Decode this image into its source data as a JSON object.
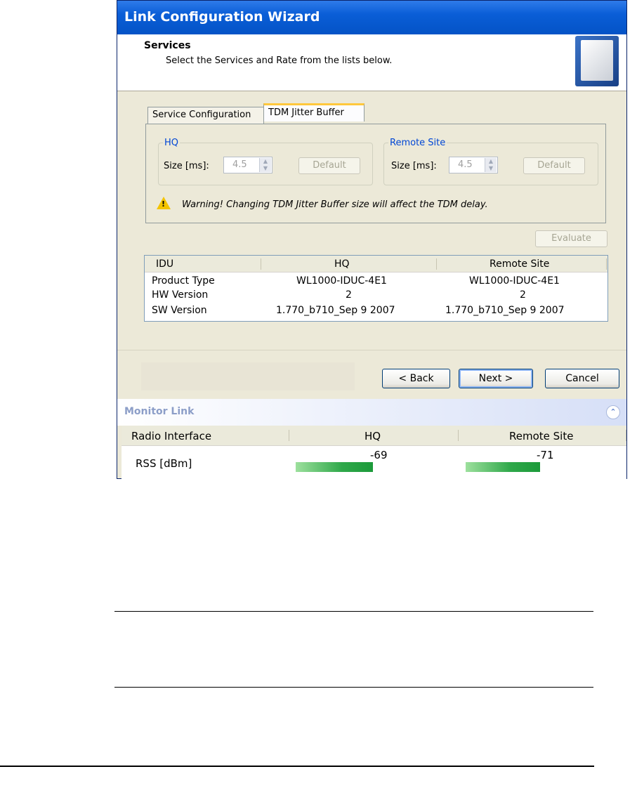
{
  "window": {
    "title": "Link Configuration Wizard",
    "header_title": "Services",
    "header_subtitle": "Select the Services and Rate from the lists below.",
    "logo_icon": "antenna-panel-icon"
  },
  "tabs": [
    {
      "label": "Service Configuration",
      "active": false
    },
    {
      "label": "TDM Jitter Buffer",
      "active": true
    }
  ],
  "jitter": {
    "hq": {
      "legend": "HQ",
      "size_label": "Size [ms]:",
      "value": "4.5",
      "default_label": "Default"
    },
    "remote": {
      "legend": "Remote Site",
      "size_label": "Size [ms]:",
      "value": "4.5",
      "default_label": "Default"
    },
    "warning": "Warning! Changing TDM Jitter Buffer size will affect the TDM delay.",
    "warning_icon": "warning-triangle-icon"
  },
  "evaluate_label": "Evaluate",
  "idu_table": {
    "columns": [
      "IDU",
      "HQ",
      "Remote Site"
    ],
    "rows": [
      [
        "Product Type",
        "WL1000-IDUC-4E1",
        "WL1000-IDUC-4E1"
      ],
      [
        "HW Version",
        "2",
        "2"
      ],
      [
        "SW Version",
        "1.770_b710_Sep  9 2007",
        "1.770_b710_Sep  9 2007"
      ]
    ]
  },
  "buttons": {
    "back": "< Back",
    "next": "Next >",
    "cancel": "Cancel"
  },
  "monitor": {
    "title": "Monitor Link",
    "collapse_icon": "double-chevron-up-icon",
    "columns": [
      "Radio Interface",
      "HQ",
      "Remote Site"
    ],
    "row_label": "RSS [dBm]",
    "hq_value": "-69",
    "remote_value": "-71",
    "hq_level": 0.48,
    "remote_level": 0.46,
    "bar_color": "#2fa84a"
  }
}
